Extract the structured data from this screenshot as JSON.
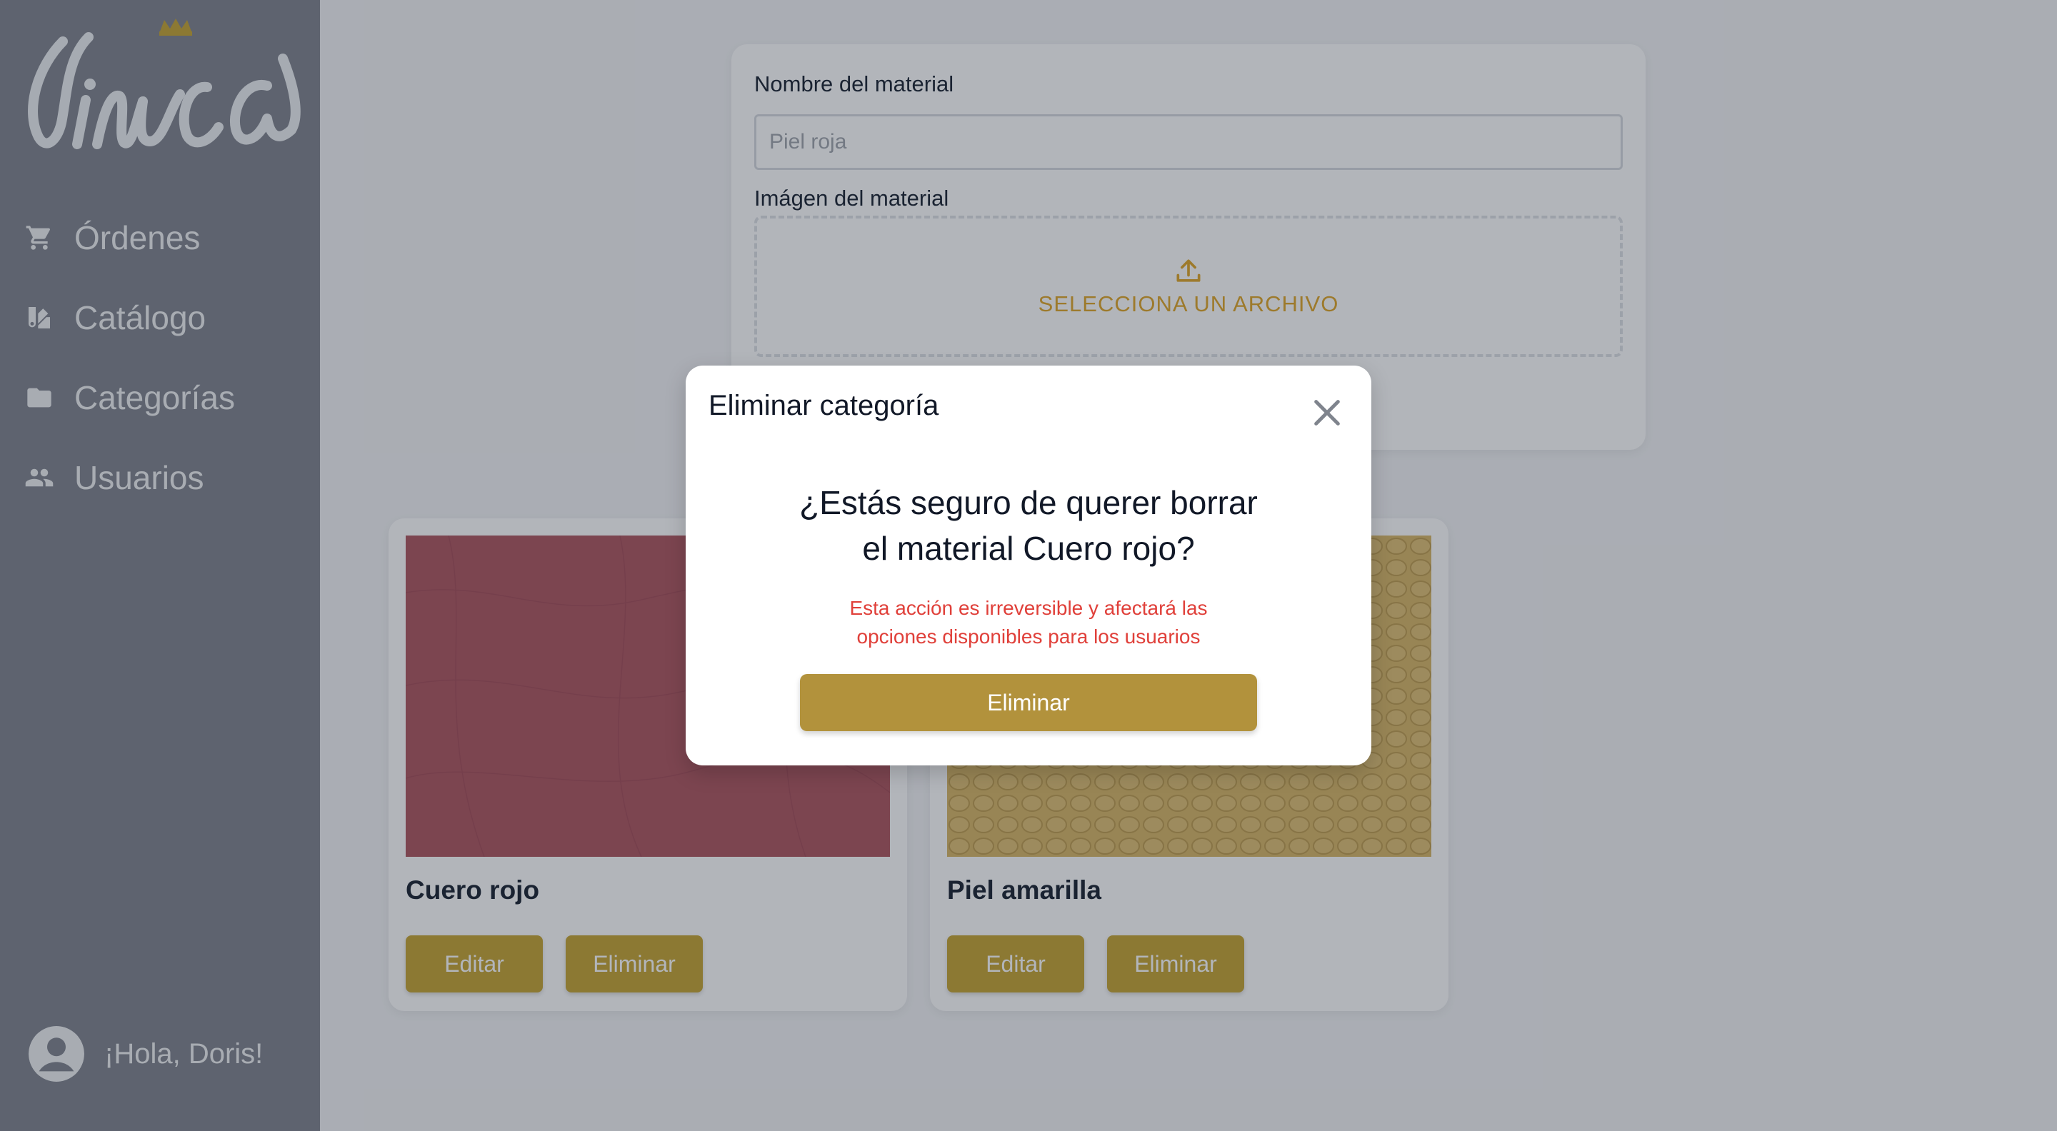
{
  "app": {
    "logo_text": "Cinica"
  },
  "sidebar": {
    "items": [
      {
        "label": "Órdenes",
        "icon": "cart-icon"
      },
      {
        "label": "Catálogo",
        "icon": "catalog-icon"
      },
      {
        "label": "Categorías",
        "icon": "folder-icon"
      },
      {
        "label": "Usuarios",
        "icon": "users-icon"
      }
    ],
    "greeting": "¡Hola, Doris!"
  },
  "form": {
    "name_label": "Nombre del material",
    "name_placeholder": "Piel roja",
    "name_value": "",
    "image_label": "Imágen del material",
    "upload_label": "SELECCIONA UN ARCHIVO"
  },
  "materials": [
    {
      "name": "Cuero rojo",
      "edit_label": "Editar",
      "delete_label": "Eliminar",
      "color": "#b05a64"
    },
    {
      "name": "Piel amarilla",
      "edit_label": "Editar",
      "delete_label": "Eliminar",
      "color": "#d9b86a"
    }
  ],
  "modal": {
    "title": "Eliminar categoría",
    "question_line1": "¿Estás seguro de querer borrar",
    "question_line2": "el material Cuero rojo?",
    "warning_line1": "Esta acción es irreversible y afectará las",
    "warning_line2": "opciones disponibles para los usuarios",
    "confirm_label": "Eliminar"
  },
  "colors": {
    "sidebar_bg": "#838791",
    "accent_gold": "#b2923c",
    "card_button": "#c8a739",
    "upload_text": "#e0a82e",
    "warning_red": "#e0403a",
    "overlay": "rgba(17,24,39,0.32)"
  }
}
